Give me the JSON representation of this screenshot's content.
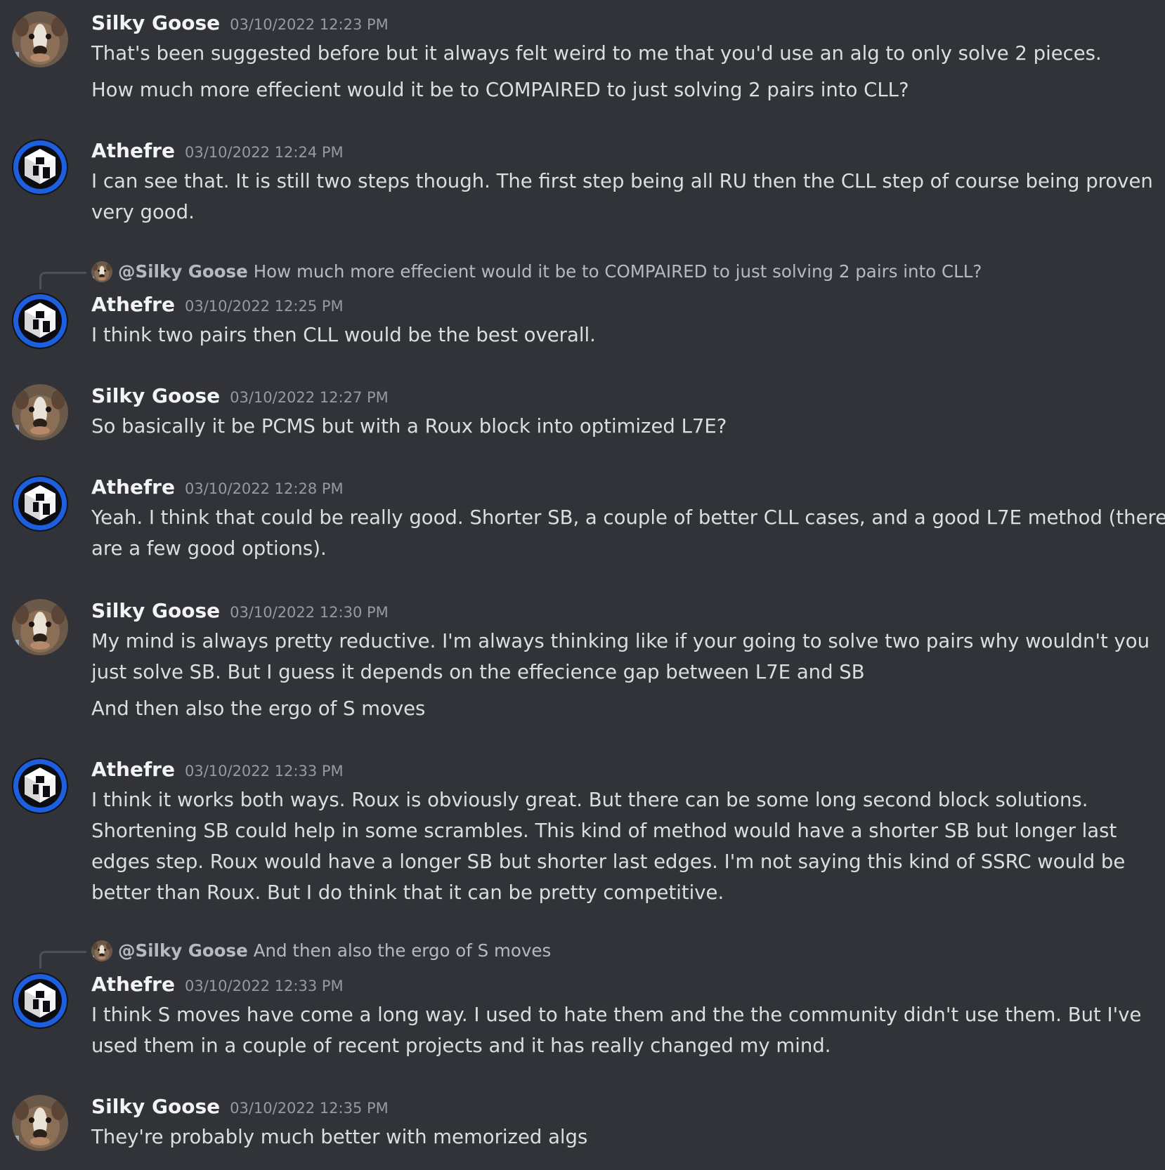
{
  "users": {
    "silky": {
      "name": "Silky Goose",
      "avatar_icon": "dog-avatar-icon"
    },
    "athefre": {
      "name": "Athefre",
      "avatar_icon": "cube-logo-avatar-icon"
    }
  },
  "colors": {
    "background": "#313338",
    "text": "#dbdee1",
    "author": "#f2f3f5",
    "timestamp": "#949ba4",
    "reply_text": "#b5bac1",
    "cube_blue": "#1e5fe0"
  },
  "messages": [
    {
      "author": "Silky Goose",
      "timestamp": "03/10/2022 12:23 PM",
      "lines": [
        "That's been suggested before but it always felt weird to me that you'd use an alg to only solve 2 pieces.",
        "How much more effecient would it be to COMPAIRED to just solving 2 pairs into CLL?"
      ]
    },
    {
      "author": "Athefre",
      "timestamp": "03/10/2022 12:24 PM",
      "lines": [
        "I can see that. It is still two steps though. The first step being all RU then the CLL step of course being proven",
        "very good."
      ]
    },
    {
      "author": "Athefre",
      "timestamp": "03/10/2022 12:25 PM",
      "reply": {
        "author": "@Silky Goose",
        "text": "How much more effecient would it be to COMPAIRED to just solving 2 pairs into CLL?"
      },
      "lines": [
        "I think two pairs then CLL would be the best overall."
      ]
    },
    {
      "author": "Silky Goose",
      "timestamp": "03/10/2022 12:27 PM",
      "lines": [
        "So basically it be PCMS but with a Roux block into optimized L7E?"
      ]
    },
    {
      "author": "Athefre",
      "timestamp": "03/10/2022 12:28 PM",
      "lines": [
        "Yeah. I think that could be really good. Shorter SB, a couple of better CLL cases, and a good L7E method (there",
        "are a few good options)."
      ]
    },
    {
      "author": "Silky Goose",
      "timestamp": "03/10/2022 12:30 PM",
      "lines": [
        "My mind is always pretty reductive. I'm always thinking like if your going to solve two pairs why wouldn't you",
        "just solve SB. But I guess it depends on the effecience gap between L7E and SB",
        "And then also the ergo of S moves"
      ]
    },
    {
      "author": "Athefre",
      "timestamp": "03/10/2022 12:33 PM",
      "lines": [
        "I think it works both ways. Roux is obviously great. But there can be some long second block solutions.",
        "Shortening SB could help in some scrambles. This kind of method would have a shorter SB but longer last",
        "edges step. Roux would have a longer SB but shorter last edges. I'm not saying this kind of SSRC would be",
        "better than Roux. But I do think that it can be pretty competitive."
      ]
    },
    {
      "author": "Athefre",
      "timestamp": "03/10/2022 12:33 PM",
      "reply": {
        "author": "@Silky Goose",
        "text": "And then also the ergo of S moves"
      },
      "lines": [
        "I think S moves have come a long way. I used to hate them and the the community didn't use them. But I've",
        "used them in a couple of recent projects and it has really changed my mind."
      ]
    },
    {
      "author": "Silky Goose",
      "timestamp": "03/10/2022 12:35 PM",
      "lines": [
        "They're probably much better with memorized algs"
      ]
    }
  ]
}
